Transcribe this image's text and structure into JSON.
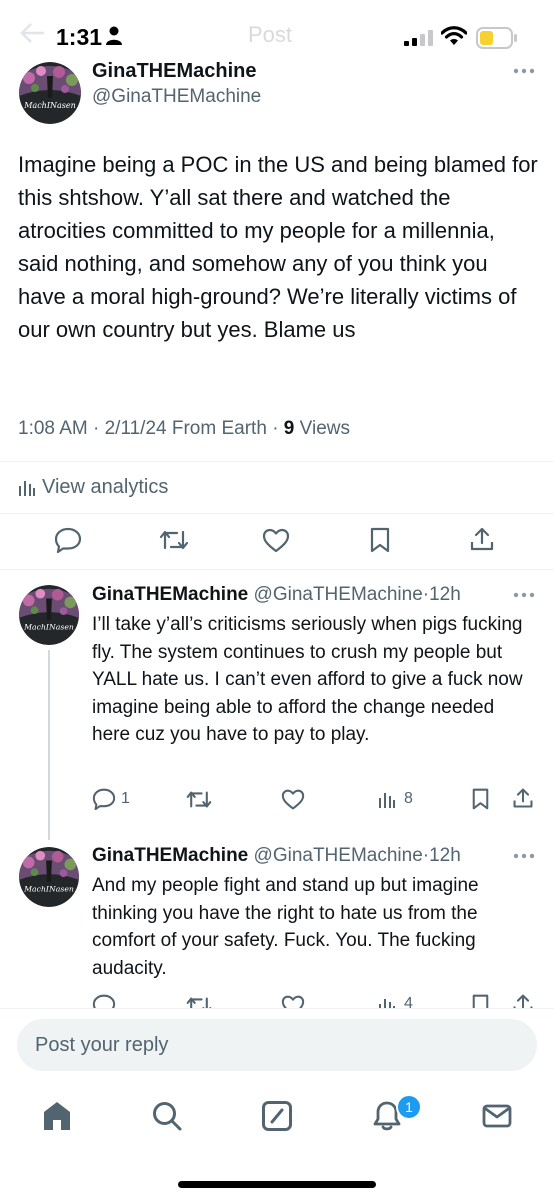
{
  "status_bar": {
    "time": "1:31",
    "faded_title": "Post"
  },
  "main_tweet": {
    "author_name": "GinaTHEMachine",
    "handle": "@GinaTHEMachine",
    "avatar_label": "MachINasen",
    "text": "Imagine being a POC in the US and being blamed for this shtshow. Y’all sat there and watched the atrocities committed to my people for a millennia, said nothing, and somehow any of you think you have a moral high-ground? We’re literally victims of our own country but yes. Blame us",
    "time": "1:08 AM",
    "date": "2/11/24",
    "source": "From Earth",
    "views_count": "9",
    "views_label": "Views",
    "analytics_label": "View analytics"
  },
  "replies": [
    {
      "author_name": "GinaTHEMachine",
      "handle": "@GinaTHEMachine",
      "time": "12h",
      "text": "I’ll take y’all’s criticisms seriously when pigs fucking fly. The system continues to crush my people but YALL hate us. I can’t even afford to give a fuck now imagine being able to afford the change needed here cuz you have to pay to play.",
      "reply_count": "1",
      "view_count": "8"
    },
    {
      "author_name": "GinaTHEMachine",
      "handle": "@GinaTHEMachine",
      "time": "12h",
      "text": "And my people fight and stand up but imagine thinking you have the right to hate us from the comfort of your safety. Fuck. You. The fucking audacity.",
      "view_count": "4"
    }
  ],
  "reply_box": {
    "placeholder": "Post your reply"
  },
  "nav": {
    "notification_badge": "1"
  },
  "colors": {
    "accent": "#1d9bf0",
    "text": "#0f1419",
    "muted": "#536471",
    "battery": "#f7d130"
  }
}
